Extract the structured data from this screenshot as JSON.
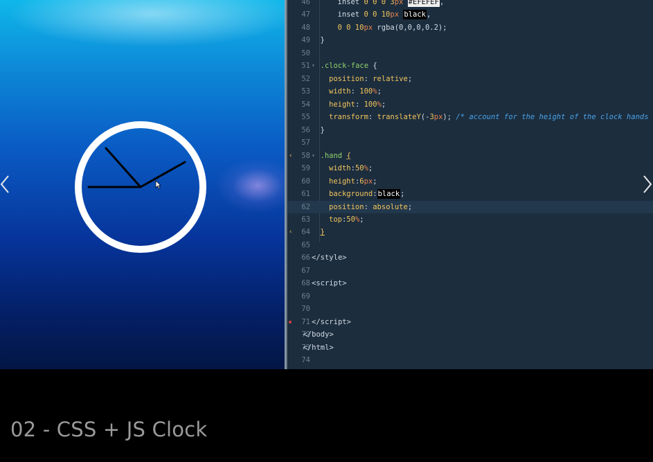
{
  "video": {
    "caption": "02 - CSS + JS Clock"
  },
  "preview": {
    "clock": {
      "hands": [
        "hour-hand",
        "minute-hand",
        "second-hand"
      ]
    }
  },
  "navigation": {
    "prev_icon": "chevron-left-icon",
    "next_icon": "chevron-right-icon"
  },
  "editor": {
    "lines": [
      {
        "n": "46",
        "indent": 3,
        "tokens": [
          [
            "inset ",
            "plain"
          ],
          [
            "0 0 0 ",
            "num"
          ],
          [
            "3",
            "num"
          ],
          [
            "px ",
            "unit"
          ],
          [
            "#EFEFEF",
            "sel"
          ],
          [
            ",",
            "plain"
          ]
        ]
      },
      {
        "n": "47",
        "indent": 3,
        "tokens": [
          [
            "inset ",
            "plain"
          ],
          [
            "0 0 ",
            "num"
          ],
          [
            "10",
            "num"
          ],
          [
            "px ",
            "unit"
          ],
          [
            "black",
            "sel"
          ],
          [
            ",",
            "plain"
          ]
        ]
      },
      {
        "n": "48",
        "indent": 3,
        "tokens": [
          [
            "0 0 ",
            "num"
          ],
          [
            "10",
            "num"
          ],
          [
            "px ",
            "unit"
          ],
          [
            "rgba(0,0,0,0.2);",
            "plain"
          ]
        ]
      },
      {
        "n": "49",
        "indent": 1,
        "tokens": [
          [
            "}",
            "plain"
          ]
        ]
      },
      {
        "n": "50",
        "indent": 0,
        "tokens": []
      },
      {
        "n": "51",
        "indent": 1,
        "fold": true,
        "tokens": [
          [
            ".clock-face",
            "selector"
          ],
          [
            " {",
            "plain"
          ]
        ]
      },
      {
        "n": "52",
        "indent": 2,
        "tokens": [
          [
            "position",
            "prop"
          ],
          [
            ": ",
            "plain"
          ],
          [
            "relative",
            "val"
          ],
          [
            ";",
            "plain"
          ]
        ]
      },
      {
        "n": "53",
        "indent": 2,
        "tokens": [
          [
            "width",
            "prop"
          ],
          [
            ": ",
            "plain"
          ],
          [
            "100",
            "num"
          ],
          [
            "%",
            "unit"
          ],
          [
            ";",
            "plain"
          ]
        ]
      },
      {
        "n": "54",
        "indent": 2,
        "tokens": [
          [
            "height",
            "prop"
          ],
          [
            ": ",
            "plain"
          ],
          [
            "100",
            "num"
          ],
          [
            "%",
            "unit"
          ],
          [
            ";",
            "plain"
          ]
        ]
      },
      {
        "n": "55",
        "indent": 2,
        "tokens": [
          [
            "transform",
            "prop"
          ],
          [
            ": ",
            "plain"
          ],
          [
            "translateY",
            "val"
          ],
          [
            "(-",
            "plain"
          ],
          [
            "3",
            "num"
          ],
          [
            "px",
            "unit"
          ],
          [
            "); ",
            "plain"
          ],
          [
            "/* account for the height of the clock hands */",
            "comment"
          ]
        ]
      },
      {
        "n": "56",
        "indent": 1,
        "tokens": [
          [
            "}",
            "plain"
          ]
        ]
      },
      {
        "n": "57",
        "indent": 0,
        "tokens": []
      },
      {
        "n": "58",
        "indent": 1,
        "fold": true,
        "warn": true,
        "tokens": [
          [
            ".hand",
            "selector"
          ],
          [
            " ",
            "plain"
          ],
          [
            "{",
            "bracket"
          ]
        ]
      },
      {
        "n": "59",
        "indent": 2,
        "tokens": [
          [
            "width",
            "prop"
          ],
          [
            ":",
            "plain"
          ],
          [
            "50",
            "num"
          ],
          [
            "%",
            "unit"
          ],
          [
            ";",
            "plain"
          ]
        ]
      },
      {
        "n": "60",
        "indent": 2,
        "tokens": [
          [
            "height",
            "prop"
          ],
          [
            ":",
            "plain"
          ],
          [
            "6",
            "num"
          ],
          [
            "px",
            "unit"
          ],
          [
            ";",
            "plain"
          ]
        ]
      },
      {
        "n": "61",
        "indent": 2,
        "tokens": [
          [
            "background",
            "prop"
          ],
          [
            ":",
            "plain"
          ],
          [
            "black",
            "sel"
          ],
          [
            ";",
            "plain"
          ]
        ]
      },
      {
        "n": "62",
        "indent": 2,
        "highlight": true,
        "tokens": [
          [
            "position",
            "prop"
          ],
          [
            ": ",
            "plain"
          ],
          [
            "absolute",
            "val"
          ],
          [
            ";",
            "plain"
          ]
        ]
      },
      {
        "n": "63",
        "indent": 2,
        "tokens": [
          [
            "top",
            "prop"
          ],
          [
            ":",
            "plain"
          ],
          [
            "50",
            "num"
          ],
          [
            "%",
            "unit"
          ],
          [
            ";",
            "plain"
          ]
        ]
      },
      {
        "n": "64",
        "indent": 1,
        "warn": true,
        "tokens": [
          [
            "}",
            "bracket"
          ]
        ]
      },
      {
        "n": "65",
        "indent": 0,
        "tokens": []
      },
      {
        "n": "66",
        "indent": 0,
        "tokens": [
          [
            "</",
            "plain"
          ],
          [
            "style",
            "tag"
          ],
          [
            ">",
            "plain"
          ]
        ]
      },
      {
        "n": "67",
        "indent": 0,
        "tokens": []
      },
      {
        "n": "68",
        "indent": 0,
        "tokens": [
          [
            "<",
            "plain"
          ],
          [
            "script",
            "tag"
          ],
          [
            ">",
            "plain"
          ]
        ]
      },
      {
        "n": "69",
        "indent": 0,
        "tokens": []
      },
      {
        "n": "70",
        "indent": 0,
        "tokens": []
      },
      {
        "n": "71",
        "indent": 0,
        "error": true,
        "tokens": [
          [
            "</",
            "plain"
          ],
          [
            "script",
            "tag"
          ],
          [
            ">",
            "plain"
          ]
        ]
      },
      {
        "n": "72",
        "indent": -1,
        "tokens": [
          [
            "</",
            "plain"
          ],
          [
            "body",
            "tag"
          ],
          [
            ">",
            "plain"
          ]
        ]
      },
      {
        "n": "73",
        "indent": -1,
        "tokens": [
          [
            "</",
            "plain"
          ],
          [
            "html",
            "tag"
          ],
          [
            ">",
            "plain"
          ]
        ]
      },
      {
        "n": "74",
        "indent": 0,
        "tokens": []
      }
    ],
    "colors": {
      "plain": "#d2dce4",
      "num": "#f2c55c",
      "unit": "#e8874f",
      "prop": "#f2c55c",
      "val": "#f2c55c",
      "selector": "#8fd16a",
      "comment": "#4aa3e8",
      "tag": "#d2dce4",
      "bracket": "#f2c55c",
      "sel_bg": "#000000",
      "sel_fg": "#ffffff",
      "sel_light_bg": "#efefef",
      "sel_light_fg": "#111111"
    }
  }
}
